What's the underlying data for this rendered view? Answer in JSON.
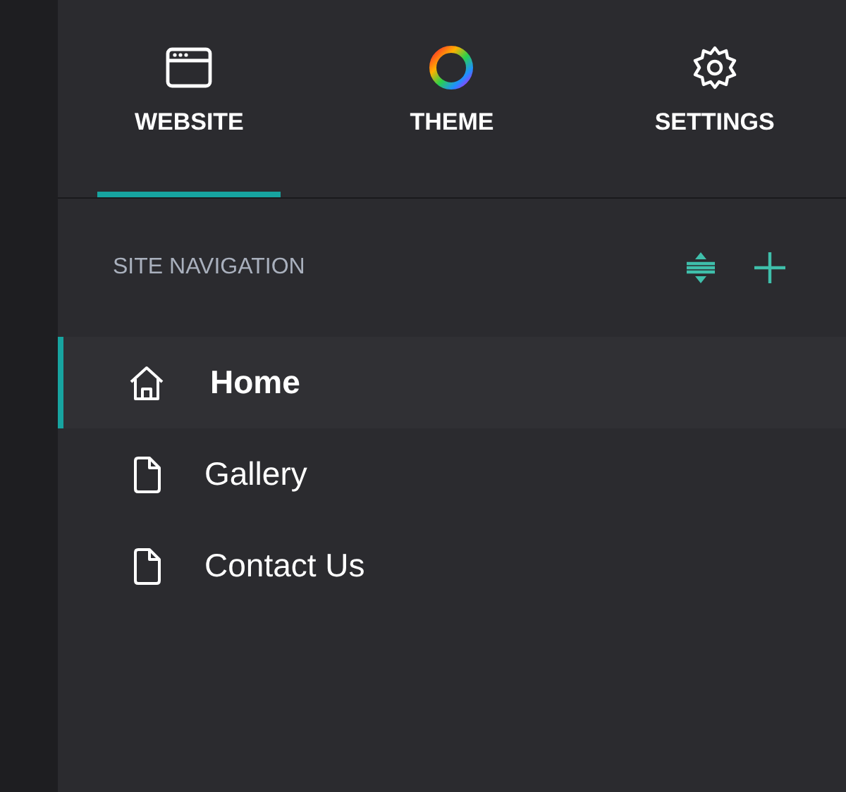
{
  "tabs": [
    {
      "label": "WEBSITE",
      "kind": "website",
      "selected": true
    },
    {
      "label": "THEME",
      "kind": "theme",
      "selected": false
    },
    {
      "label": "SETTINGS",
      "kind": "settings",
      "selected": false
    }
  ],
  "section": {
    "title": "SITE NAVIGATION"
  },
  "nav_items": [
    {
      "label": "Home",
      "kind": "home",
      "selected": true
    },
    {
      "label": "Gallery",
      "kind": "page",
      "selected": false
    },
    {
      "label": "Contact Us",
      "kind": "page",
      "selected": false
    }
  ]
}
